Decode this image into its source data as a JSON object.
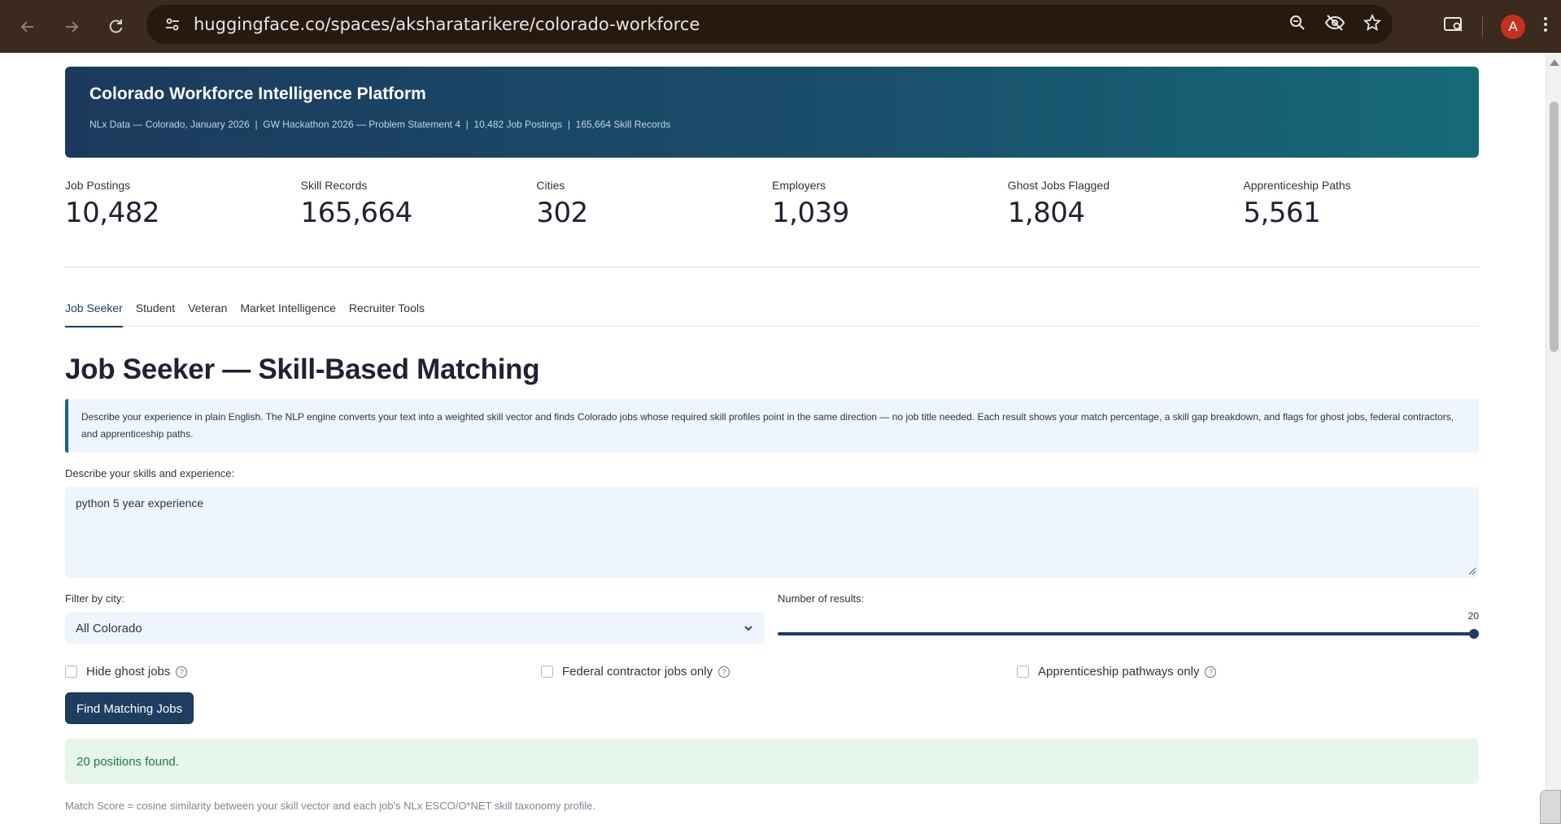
{
  "browser": {
    "url": "huggingface.co/spaces/aksharatarikere/colorado-workforce",
    "profile_initial": "A"
  },
  "header": {
    "title": "Colorado Workforce Intelligence Platform",
    "subtitle": "NLx Data — Colorado, January 2026  |  GW Hackathon 2026 — Problem Statement 4  |  10,482 Job Postings  |  165,664 Skill Records"
  },
  "metrics": [
    {
      "label": "Job Postings",
      "value": "10,482"
    },
    {
      "label": "Skill Records",
      "value": "165,664"
    },
    {
      "label": "Cities",
      "value": "302"
    },
    {
      "label": "Employers",
      "value": "1,039"
    },
    {
      "label": "Ghost Jobs Flagged",
      "value": "1,804"
    },
    {
      "label": "Apprenticeship Paths",
      "value": "5,561"
    }
  ],
  "tabs": [
    {
      "label": "Job Seeker",
      "active": true
    },
    {
      "label": "Student"
    },
    {
      "label": "Veteran"
    },
    {
      "label": "Market Intelligence"
    },
    {
      "label": "Recruiter Tools"
    }
  ],
  "main": {
    "title": "Job Seeker — Skill-Based Matching",
    "info": "Describe your experience in plain English. The NLP engine converts your text into a weighted skill vector and finds Colorado jobs whose required skill profiles point in the same direction — no job title needed. Each result shows your match percentage, a skill gap breakdown, and flags for ghost jobs, federal contractors, and apprenticeship paths.",
    "skills_label": "Describe your skills and experience:",
    "skills_value": "python 5 year experience",
    "city_label": "Filter by city:",
    "city_value": "All Colorado",
    "results_label": "Number of results:",
    "results_value": "20",
    "results_fill_fraction": 1.0,
    "checkboxes": [
      {
        "label": "Hide ghost jobs",
        "checked": false
      },
      {
        "label": "Federal contractor jobs only",
        "checked": false
      },
      {
        "label": "Apprenticeship pathways only",
        "checked": false
      }
    ],
    "button_label": "Find Matching Jobs",
    "success_text": "20 positions found.",
    "caption": "Match Score = cosine similarity between your skill vector and each job's NLx ESCO/O*NET skill taxonomy profile."
  },
  "colors": {
    "primary": "#1f3d61",
    "hero_start": "#1c3a5d",
    "hero_end": "#166a78",
    "success_bg": "#e6f6ea",
    "success_text": "#237a3b"
  }
}
